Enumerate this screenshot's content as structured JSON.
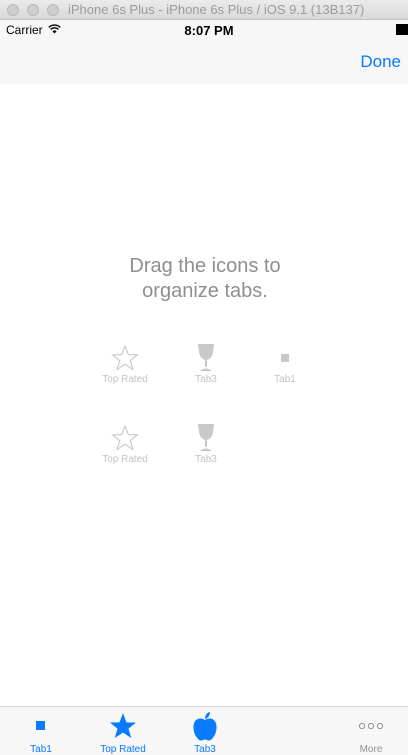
{
  "window": {
    "title": "iPhone 6s Plus - iPhone 6s Plus / iOS 9.1 (13B137)"
  },
  "status_bar": {
    "carrier": "Carrier",
    "time": "8:07 PM"
  },
  "nav_bar": {
    "done_label": "Done"
  },
  "content": {
    "instruction": "Drag the icons to\norganize tabs.",
    "customize_items": [
      {
        "label": "Top Rated",
        "icon": "star-outline-icon"
      },
      {
        "label": "Tab3",
        "icon": "goblet-icon"
      },
      {
        "label": "Tab1",
        "icon": "square-icon"
      },
      {
        "label": "Top Rated",
        "icon": "star-outline-icon"
      },
      {
        "label": "Tab3",
        "icon": "goblet-icon"
      }
    ]
  },
  "tab_bar": {
    "items": [
      {
        "label": "Tab1",
        "icon": "square-icon"
      },
      {
        "label": "Top Rated",
        "icon": "star-filled-icon"
      },
      {
        "label": "Tab3",
        "icon": "apple-icon"
      },
      {
        "label": "More",
        "icon": "more-dots-icon"
      }
    ]
  },
  "colors": {
    "accent": "#0a7aff",
    "inactive": "#929292",
    "disabled_icon": "#c8c8c8"
  }
}
